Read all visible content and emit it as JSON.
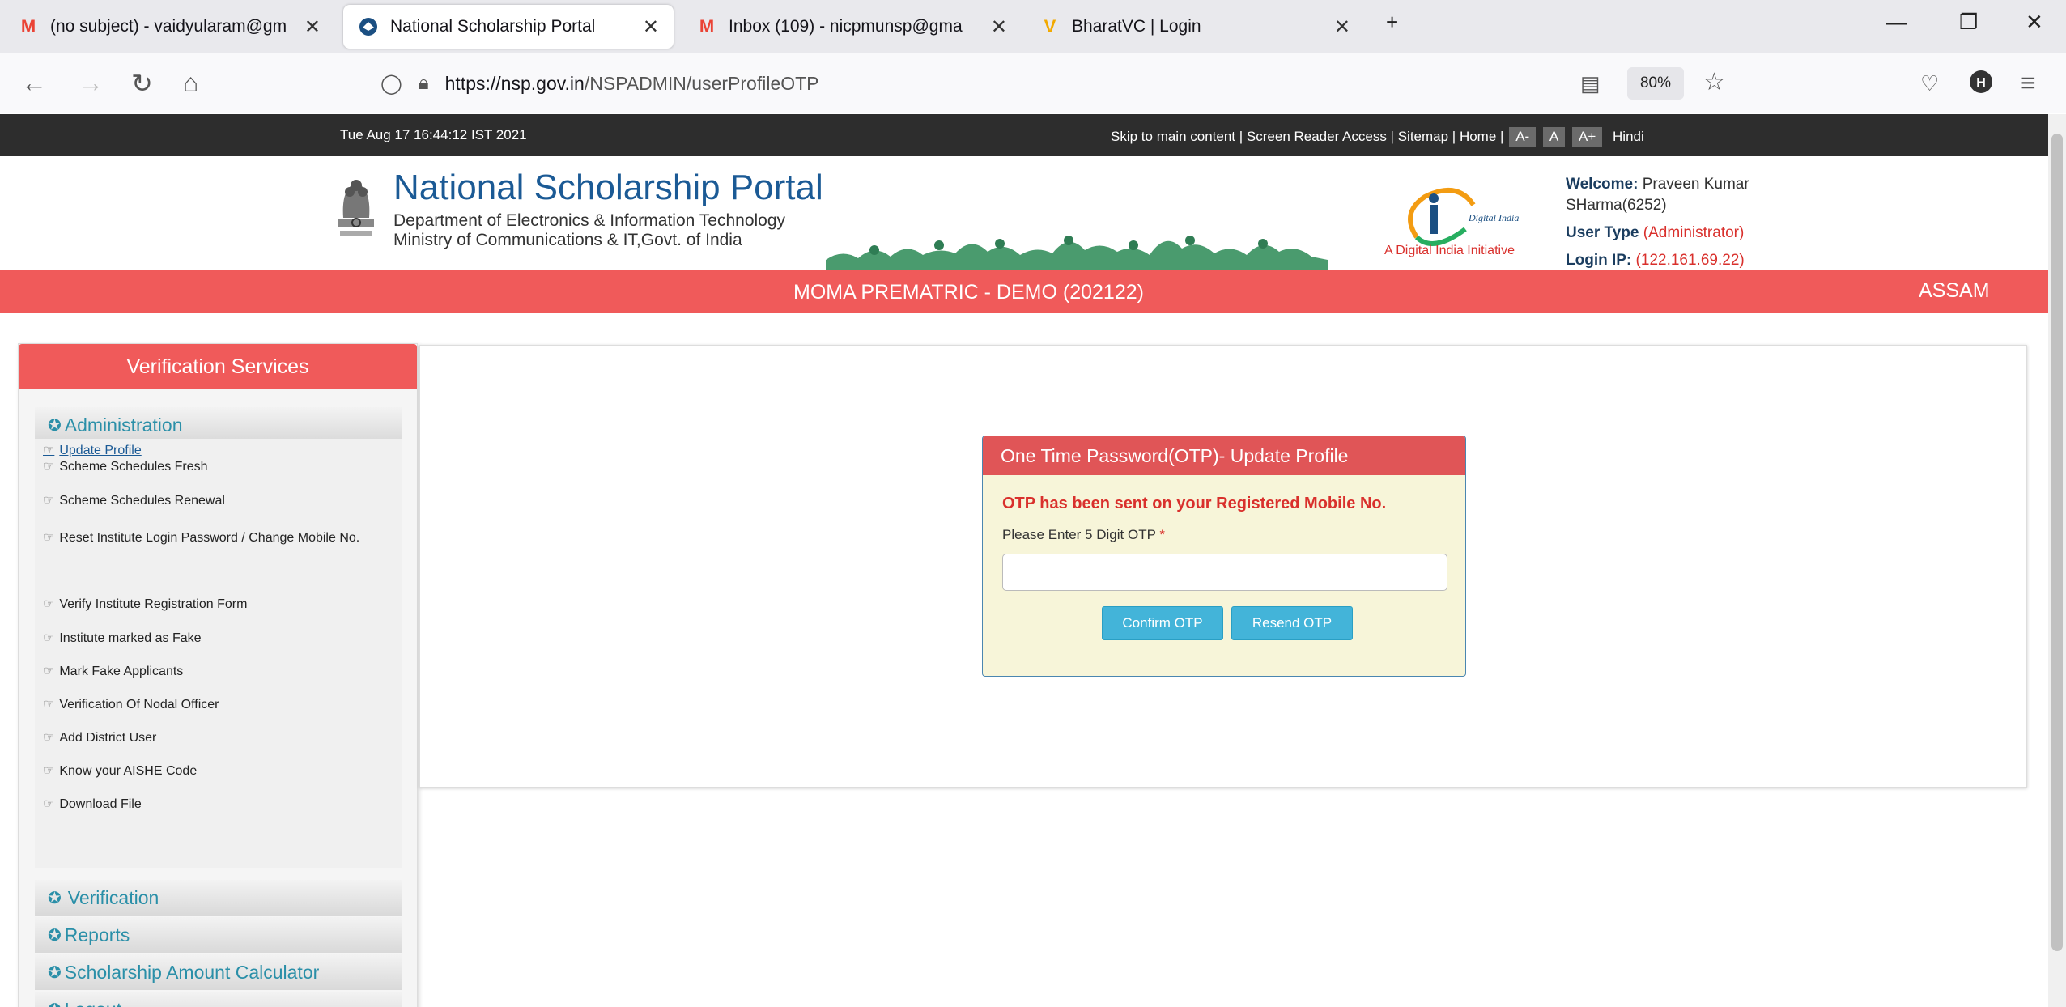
{
  "browser": {
    "tabs": [
      {
        "icon": "gmail-icon",
        "title": "(no subject) - vaidyularam@gm"
      },
      {
        "icon": "nsp-icon",
        "title": "National Scholarship Portal"
      },
      {
        "icon": "gmail-icon",
        "title": "Inbox (109) - nicpmunsp@gma"
      },
      {
        "icon": "bharatvc-icon",
        "title": "BharatVC | Login"
      }
    ],
    "url_host": "https://nsp.gov.in",
    "url_path": "/NSPADMIN/userProfileOTP",
    "zoom": "80%"
  },
  "topstrip": {
    "datetime": "Tue Aug 17 16:44:12 IST 2021",
    "skip": "Skip to main content",
    "screen_reader": "Screen Reader Access",
    "sitemap": "Sitemap",
    "home": "Home",
    "font_small": "A-",
    "font_normal": "A",
    "font_large": "A+",
    "hindi": "Hindi"
  },
  "header": {
    "title": "National Scholarship Portal",
    "dept": "Department of Electronics & Information Technology",
    "ministry": "Ministry of Communications & IT,Govt. of India",
    "di_tag": "A Digital India Initiative",
    "di_logo_text": "Digital India",
    "welcome_label": "Welcome:",
    "welcome_name": "Praveen Kumar",
    "welcome_name2": "SHarma(6252)",
    "usertype_label": "User Type",
    "usertype_value": "(Administrator)",
    "loginip_label": "Login IP:",
    "loginip_value": "(122.161.69.22)"
  },
  "redbar": {
    "scheme": "MOMA PREMATRIC - DEMO (202122)",
    "state": "ASSAM"
  },
  "sidebar": {
    "heading": "Verification Services",
    "admin_label": "Administration",
    "items": [
      "Update Profile",
      "Scheme Schedules Fresh",
      "Scheme Schedules Renewal",
      "Reset Institute Login Password / Change Mobile No.",
      "Verify Institute Registration Form",
      "Institute marked as Fake",
      "Mark Fake Applicants",
      "Verification Of Nodal Officer",
      "Add District User",
      "Know your AISHE Code",
      "Download File"
    ],
    "verification_label": "Verification",
    "reports_label": "Reports",
    "calculator_label": "Scholarship Amount Calculator",
    "logout_label": "Logout"
  },
  "otp": {
    "heading": "One Time Password(OTP)- Update Profile",
    "message": "OTP has been sent on your Registered Mobile No.",
    "label": "Please Enter 5 Digit OTP",
    "required_mark": "*",
    "input_value": "",
    "confirm_label": "Confirm OTP",
    "resend_label": "Resend OTP"
  }
}
